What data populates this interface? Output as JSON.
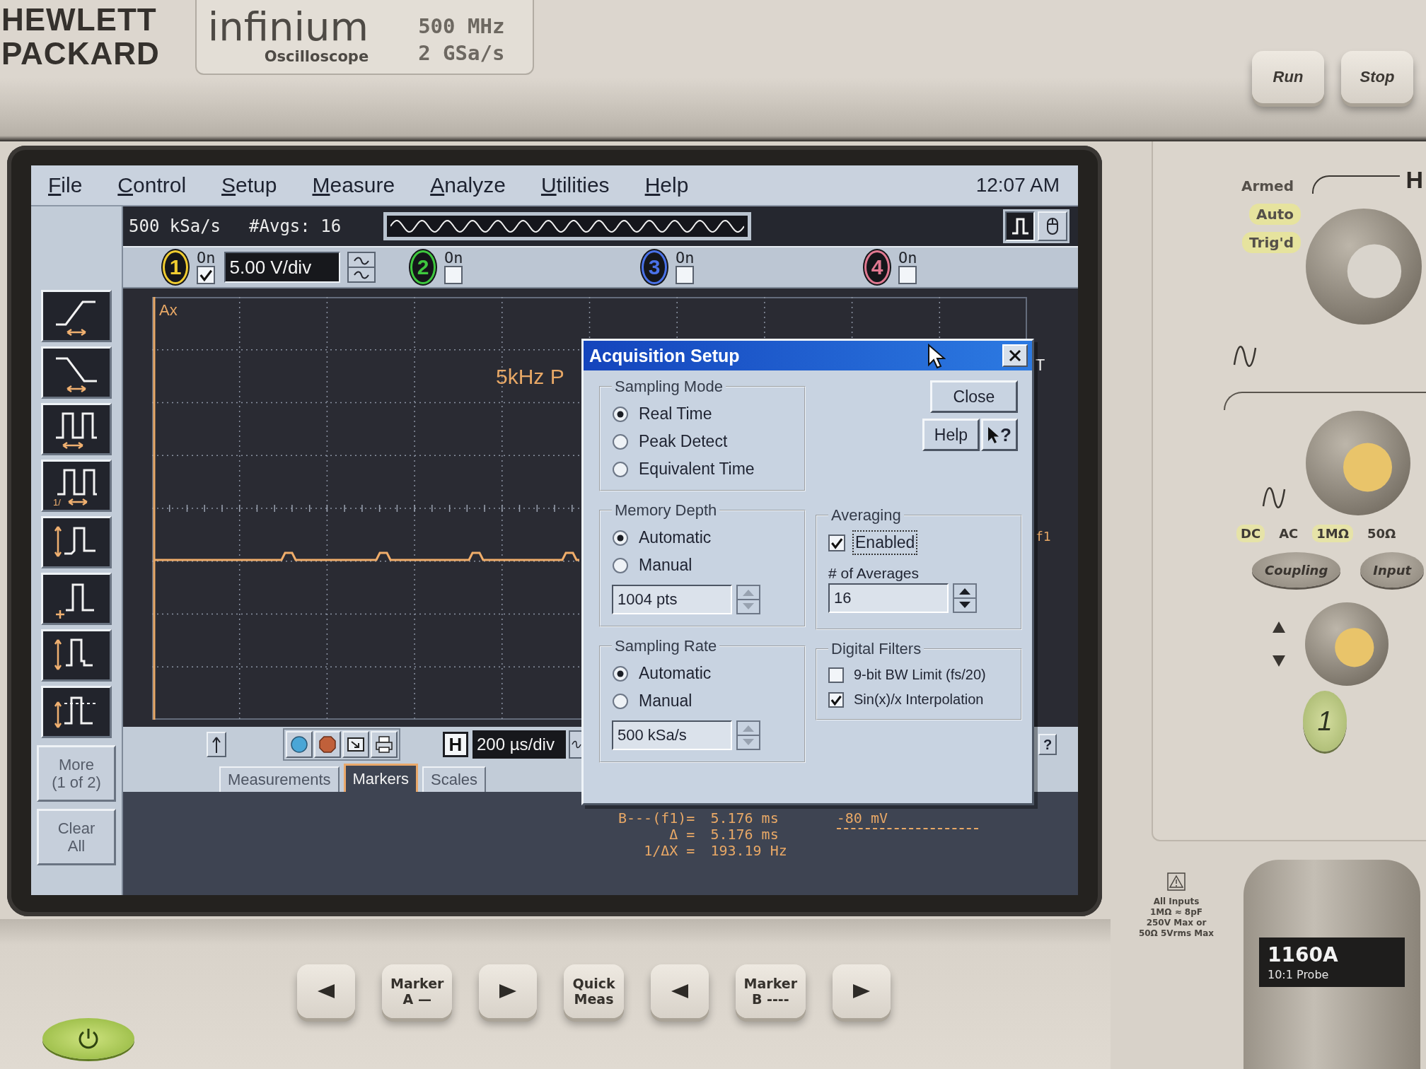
{
  "bezel": {
    "brand": [
      "HEWLETT",
      "PACKARD"
    ],
    "product": "infinium",
    "product_subtitle": "Oscilloscope",
    "specs": [
      "500 MHz",
      "2 GSa/s"
    ],
    "keys": [
      "Run",
      "Stop"
    ]
  },
  "menu": {
    "items": [
      "File",
      "Control",
      "Setup",
      "Measure",
      "Analyze",
      "Utilities",
      "Help"
    ],
    "clock": "12:07 AM"
  },
  "status": {
    "sample_rate": "500 kSa/s",
    "averages": "#Avgs: 16",
    "view_buttons": [
      {
        "kind": "pulse",
        "selected": true
      },
      {
        "kind": "mouse",
        "selected": false
      }
    ]
  },
  "channels": [
    {
      "number": "1",
      "on_label": "On",
      "on": true,
      "color": "#f0cc30",
      "scale": "5.00 V/div"
    },
    {
      "number": "2",
      "on_label": "On",
      "on": false,
      "color": "#3ec83e"
    },
    {
      "number": "3",
      "on_label": "On",
      "on": false,
      "color": "#4a72e8"
    },
    {
      "number": "4",
      "on_label": "On",
      "on": false,
      "color": "#e07890"
    }
  ],
  "measure_tools": [
    {
      "kind": "rise"
    },
    {
      "kind": "fall"
    },
    {
      "kind": "period"
    },
    {
      "kind": "frequency",
      "label": "1/"
    },
    {
      "kind": "amplitude"
    },
    {
      "kind": "base"
    },
    {
      "kind": "top"
    },
    {
      "kind": "overshoot"
    }
  ],
  "side_buttons": [
    {
      "lines": [
        "More",
        "(1 of 2)"
      ]
    },
    {
      "lines": [
        "Clear",
        "All"
      ]
    }
  ],
  "graticule": {
    "marker_a": "Ax",
    "title": "5kHz P",
    "trigger": "T",
    "marker": "f1"
  },
  "toolbar": {
    "buttons": [
      {
        "kind": "run"
      },
      {
        "kind": "stop"
      },
      {
        "kind": "autoscale"
      },
      {
        "kind": "print"
      }
    ],
    "horizontal": "H",
    "timebase": "200 µs/div",
    "help": "?"
  },
  "tabs": [
    {
      "label": "Measurements",
      "selected": false
    },
    {
      "label": "Markers",
      "selected": true
    },
    {
      "label": "Scales",
      "selected": false
    }
  ],
  "readout": {
    "rows": [
      {
        "label": "B---(f1)=",
        "value": "5.176 ms"
      },
      {
        "label": "Δ =",
        "value": "5.176 ms"
      },
      {
        "label": "1/ΔX =",
        "value": "193.19 Hz"
      }
    ],
    "voltage": "-80 mV"
  },
  "dialog": {
    "title": "Acquisition Setup",
    "close_button": "Close",
    "help_button": "Help",
    "context_help": "?",
    "sampling_mode": {
      "title": "Sampling Mode",
      "options": [
        {
          "label": "Real Time",
          "selected": true
        },
        {
          "label": "Peak Detect",
          "selected": false
        },
        {
          "label": "Equivalent Time",
          "selected": false
        }
      ]
    },
    "memory_depth": {
      "title": "Memory Depth",
      "options": [
        {
          "label": "Automatic",
          "selected": true
        },
        {
          "label": "Manual",
          "selected": false
        }
      ],
      "value": "1004 pts",
      "disabled": true
    },
    "sampling_rate": {
      "title": "Sampling Rate",
      "options": [
        {
          "label": "Automatic",
          "selected": true
        },
        {
          "label": "Manual",
          "selected": false
        }
      ],
      "value": "500 kSa/s",
      "disabled": true
    },
    "averaging": {
      "title": "Averaging",
      "enabled": {
        "label": "Enabled",
        "checked": true,
        "focused": true
      },
      "count_label": "# of Averages",
      "value": "16",
      "disabled": false
    },
    "digital_filters": {
      "title": "Digital Filters",
      "options": [
        {
          "label": "9-bit BW Limit (fs/20)",
          "checked": false
        },
        {
          "label": "Sin(x)/x Interpolation",
          "checked": true
        }
      ]
    }
  },
  "front_panel": {
    "trigger_status": [
      {
        "label": "Armed",
        "lit": false
      },
      {
        "label": "Auto",
        "lit": true
      },
      {
        "label": "Trig'd",
        "lit": true
      }
    ],
    "horizontal_label": "H",
    "coupling_options": [
      {
        "label": "DC",
        "lit": true
      },
      {
        "label": "AC",
        "lit": false
      }
    ],
    "impedance_options": [
      {
        "label": "1MΩ",
        "lit": true
      },
      {
        "label": "50Ω",
        "lit": false
      }
    ],
    "buttons": [
      "Coupling",
      "Input"
    ],
    "channel_key": "1",
    "input_note": [
      "All Inputs",
      "1MΩ ≈ 8pF",
      "250V Max or",
      "50Ω 5Vrms Max"
    ]
  },
  "probe": {
    "model": "1160A",
    "type": "10:1 Probe"
  },
  "bottom_keys": [
    {
      "kind": "left"
    },
    {
      "kind": "label",
      "lines": [
        "Marker",
        "A —"
      ]
    },
    {
      "kind": "right"
    },
    {
      "kind": "label",
      "lines": [
        "Quick",
        "Meas"
      ]
    },
    {
      "kind": "left"
    },
    {
      "kind": "label",
      "lines": [
        "Marker",
        "B ----"
      ]
    },
    {
      "kind": "right"
    }
  ]
}
